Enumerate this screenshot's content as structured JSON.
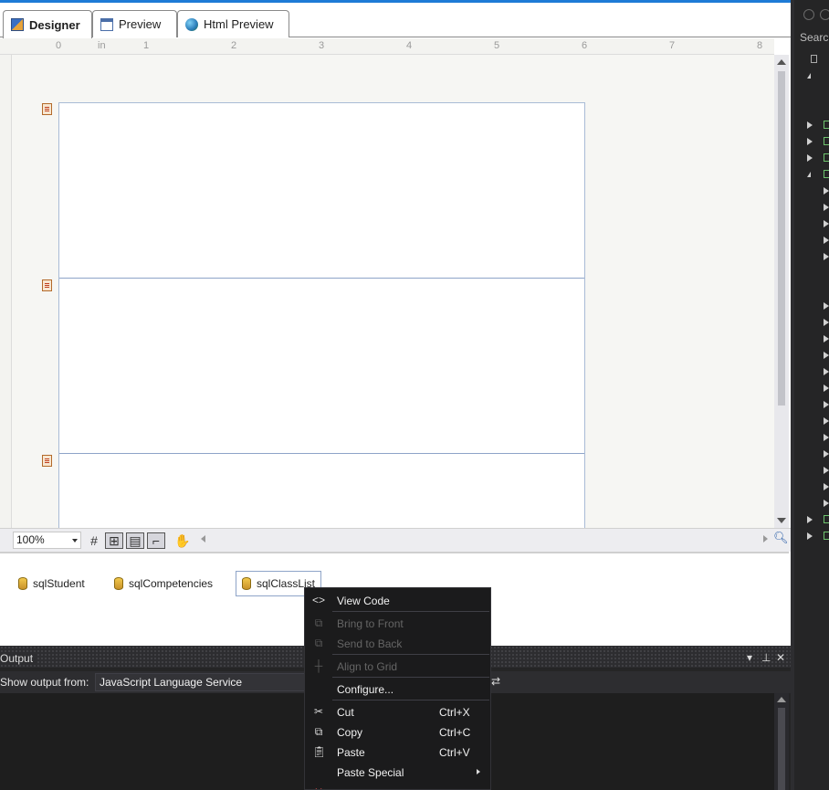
{
  "tabs": [
    {
      "label": "Designer",
      "active": true,
      "icon": "designer-icon"
    },
    {
      "label": "Preview",
      "active": false,
      "icon": "preview-icon"
    },
    {
      "label": "Html Preview",
      "active": false,
      "icon": "globe-icon"
    }
  ],
  "ruler": {
    "unit": "in",
    "ticks": [
      "0",
      "1",
      "2",
      "3",
      "4",
      "5",
      "6",
      "7",
      "8"
    ]
  },
  "toolbar": {
    "zoom": "100%"
  },
  "tray": {
    "components": [
      {
        "label": "sqlStudent",
        "selected": false
      },
      {
        "label": "sqlCompetencies",
        "selected": false
      },
      {
        "label": "sqlClassList",
        "selected": true
      }
    ]
  },
  "output": {
    "title": "Output",
    "show_output_from": "Show output from:",
    "source": "JavaScript Language Service"
  },
  "right_pane": {
    "search": "Search"
  },
  "context_menu": {
    "items": [
      {
        "label": "View Code",
        "shortcut": "",
        "enabled": true,
        "icon": "view-code-icon"
      },
      {
        "label": "Bring to Front",
        "shortcut": "",
        "enabled": false,
        "icon": "bring-to-front-icon"
      },
      {
        "label": "Send to Back",
        "shortcut": "",
        "enabled": false,
        "icon": "send-to-back-icon"
      },
      {
        "label": "Align to Grid",
        "shortcut": "",
        "enabled": false,
        "icon": "align-grid-icon"
      },
      {
        "label": "Configure...",
        "shortcut": "",
        "enabled": true,
        "icon": ""
      },
      {
        "label": "Cut",
        "shortcut": "Ctrl+X",
        "enabled": true,
        "icon": "cut-icon"
      },
      {
        "label": "Copy",
        "shortcut": "Ctrl+C",
        "enabled": true,
        "icon": "copy-icon"
      },
      {
        "label": "Paste",
        "shortcut": "Ctrl+V",
        "enabled": true,
        "icon": "paste-icon"
      },
      {
        "label": "Paste Special",
        "shortcut": "",
        "enabled": true,
        "icon": "",
        "submenu": true
      }
    ]
  },
  "colors": {
    "accent": "#1e7bd6",
    "dark_bg": "#252526",
    "menu_bg": "#1b1b1c"
  }
}
